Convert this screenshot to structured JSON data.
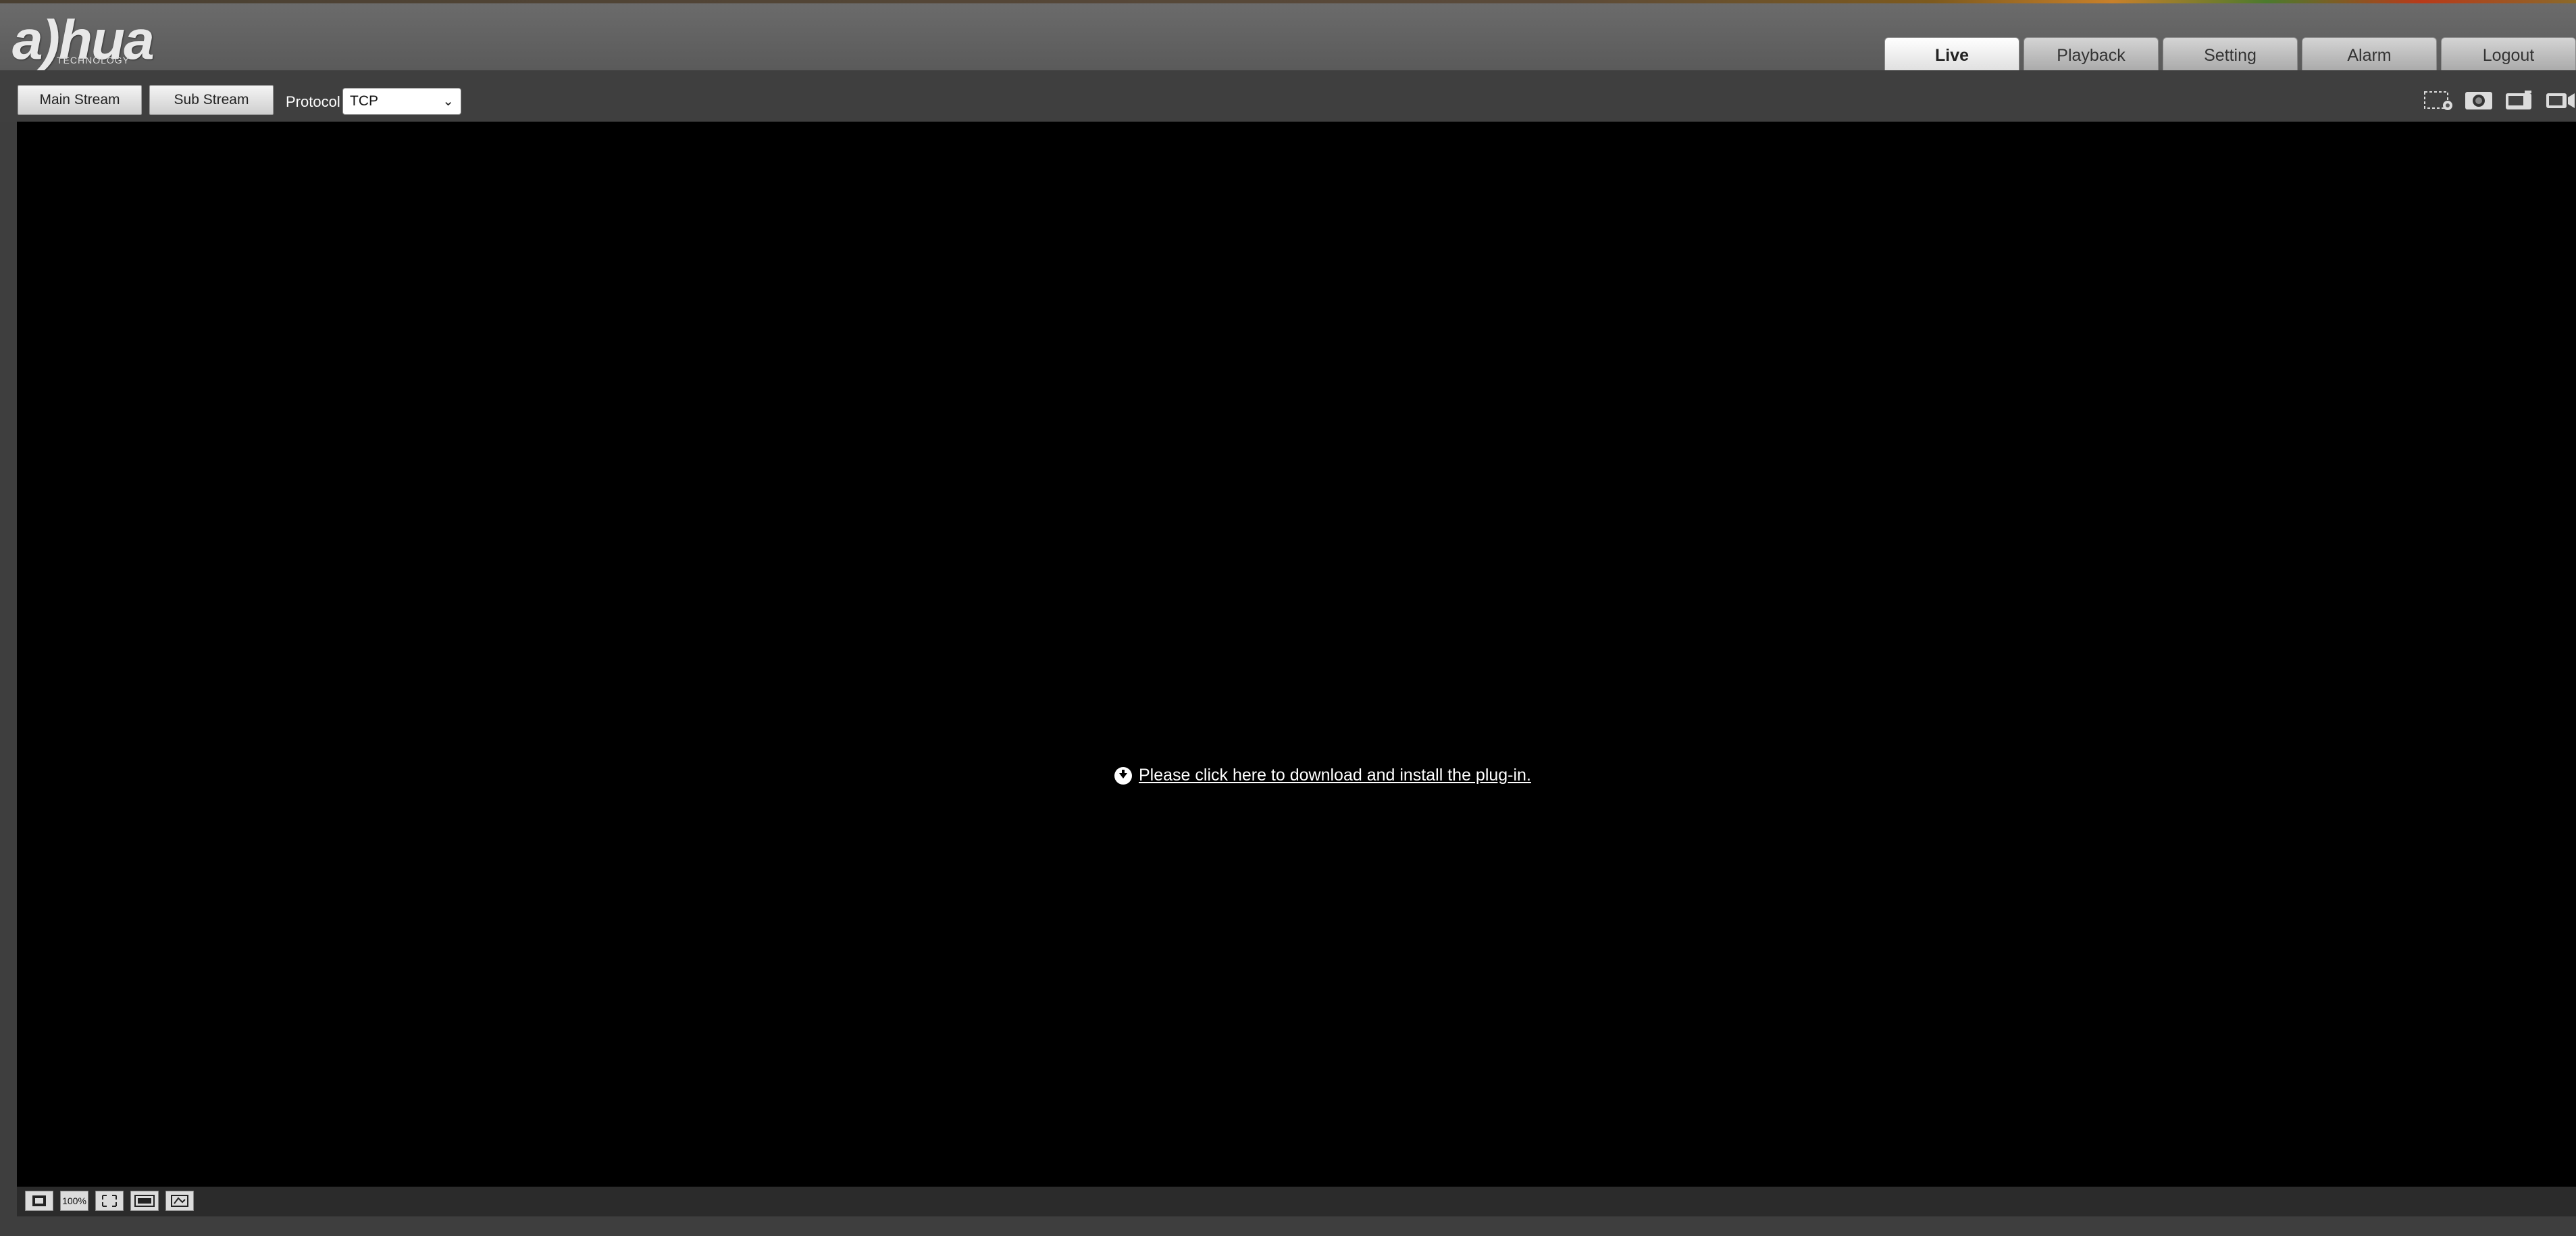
{
  "header": {
    "logo_text": "a)hua",
    "logo_subtext": "TECHNOLOGY",
    "tabs": [
      {
        "label": "Live",
        "active": true
      },
      {
        "label": "Playback",
        "active": false
      },
      {
        "label": "Setting",
        "active": false
      },
      {
        "label": "Alarm",
        "active": false
      },
      {
        "label": "Logout",
        "active": false
      }
    ]
  },
  "toolbar": {
    "main_stream_label": "Main Stream",
    "sub_stream_label": "Sub Stream",
    "protocol_label": "Protocol",
    "protocol_value": "TCP",
    "icons": [
      "region-zoom-icon",
      "snapshot-icon",
      "triple-snapshot-icon",
      "record-icon"
    ]
  },
  "video": {
    "plugin_message": "Please click here to download and install the plug-in."
  },
  "bottom_bar": {
    "icons": [
      "original-size-icon",
      "zoom-100-icon",
      "fullscreen-icon",
      "width-height-ratio-icon",
      "fluency-icon"
    ],
    "zoom_label": "100%"
  },
  "colors": {
    "header_bg": "#5f5f5f",
    "page_bg": "#3e3e3e",
    "video_bg": "#000000",
    "active_tab_bg": "#ffffff"
  }
}
